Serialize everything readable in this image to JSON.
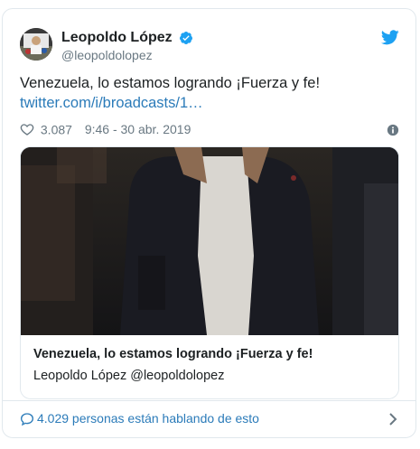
{
  "tweet": {
    "display_name": "Leopoldo López",
    "handle": "@leopoldolopez",
    "text": "Venezuela, lo estamos logrando ¡Fuerza y fe!",
    "link": "twitter.com/i/broadcasts/1…",
    "likes": "3.087",
    "timestamp": "9:46 - 30 abr. 2019"
  },
  "media_card": {
    "title": "Venezuela, lo estamos logrando ¡Fuerza y fe!",
    "author": "Leopoldo López @leopoldolopez"
  },
  "footer": {
    "conversation_text": "4.029 personas están hablando de esto"
  },
  "icons": {
    "verified": "verified-badge-icon",
    "bird": "twitter-bird-icon",
    "heart": "heart-icon",
    "info": "info-icon",
    "bubble": "speech-bubble-icon",
    "chevron": "chevron-right-icon"
  },
  "colors": {
    "accent": "#1da1f2",
    "link": "#2b7bb9",
    "muted": "#697882",
    "border": "#e1e8ed"
  }
}
